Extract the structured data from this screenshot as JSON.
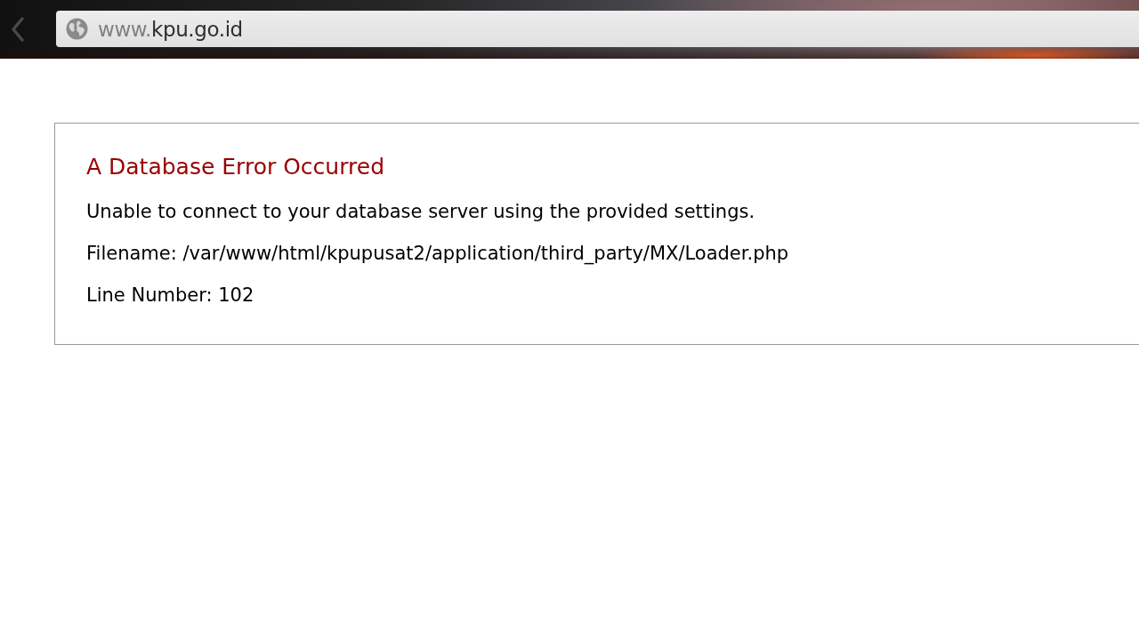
{
  "toolbar": {
    "back_button": {
      "disabled": true
    },
    "address_bar": {
      "subdomain": "www.",
      "host": "kpu.go.id"
    }
  },
  "error": {
    "heading": "A Database Error Occurred",
    "lines": [
      "Unable to connect to your database server using the provided settings.",
      "Filename: /var/www/html/kpupusat2/application/third_party/MX/Loader.php",
      "Line Number: 102"
    ]
  }
}
